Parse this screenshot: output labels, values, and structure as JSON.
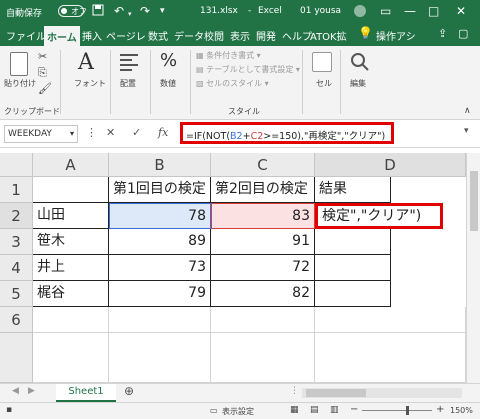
{
  "titlebar": {
    "autosave_label": "自動保存",
    "autosave_state": "オフ",
    "filename": "131.xlsx",
    "app": "Excel",
    "user": "01 yousa"
  },
  "tabs": [
    "ファイル",
    "ホーム",
    "挿入",
    "ページレ",
    "数式",
    "データ",
    "校閲",
    "表示",
    "開発",
    "ヘルプ",
    "ATOK拡",
    "操作アシ"
  ],
  "ribbon": {
    "paste": "貼り付け",
    "clipboard": "クリップボード",
    "font": "フォント",
    "alignment": "配置",
    "number": "数値",
    "cond_format": "条件付き書式",
    "table_format": "テーブルとして書式設定",
    "cell_style": "セルのスタイル",
    "style_group": "スタイル",
    "cells": "セル",
    "editing": "編集",
    "percent": "%"
  },
  "formulabar": {
    "name_box": "WEEKDAY",
    "formula": "=IF(NOT(B2+C2>=150),\"再検定\",\"クリア\")",
    "cancel": "✕",
    "enter": "✓",
    "fx": "fx"
  },
  "columns": [
    "A",
    "B",
    "C",
    "D"
  ],
  "rows": [
    "1",
    "2",
    "3",
    "4",
    "5",
    "6"
  ],
  "headers": {
    "b": "第1回目の検定",
    "c": "第2回目の検定",
    "d": "結果"
  },
  "data": [
    {
      "name": "山田",
      "b": "78",
      "c": "83",
      "d": "検定\",\"クリア\")"
    },
    {
      "name": "笹木",
      "b": "89",
      "c": "91",
      "d": ""
    },
    {
      "name": "井上",
      "b": "73",
      "c": "72",
      "d": ""
    },
    {
      "name": "梶谷",
      "b": "79",
      "c": "82",
      "d": ""
    }
  ],
  "sheet": {
    "name": "Sheet1"
  },
  "status": {
    "display_settings": "表示設定",
    "zoom": "150%"
  }
}
